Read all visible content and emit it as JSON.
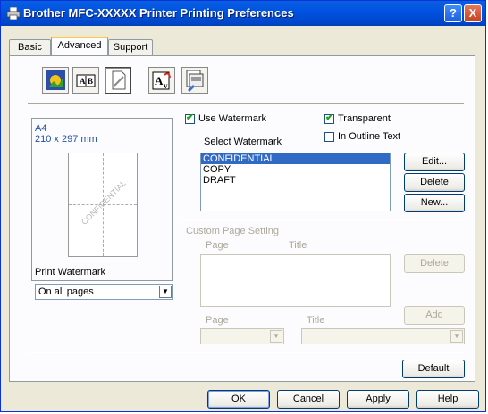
{
  "window": {
    "title": "Brother MFC-XXXXX Printer Printing Preferences",
    "help_glyph": "?",
    "close_glyph": "X"
  },
  "tabs": [
    "Basic",
    "Advanced",
    "Support"
  ],
  "tools": [
    "color-quality-icon",
    "scaling-icon",
    "watermark-icon",
    "header-footer-icon",
    "device-options-icon"
  ],
  "preview": {
    "paper": "A4",
    "size": "210 x 297 mm",
    "watermark_text": "CONFIDENTIAL"
  },
  "print_watermark": {
    "label": "Print Watermark",
    "value": "On all pages"
  },
  "use_watermark": {
    "label": "Use Watermark",
    "checked": true
  },
  "transparent": {
    "label": "Transparent",
    "checked": true
  },
  "in_outline": {
    "label": "In Outline Text",
    "checked": false
  },
  "select_watermark": {
    "label": "Select Watermark",
    "items": [
      "CONFIDENTIAL",
      "COPY",
      "DRAFT"
    ],
    "selected": "CONFIDENTIAL"
  },
  "watermark_buttons": {
    "edit": "Edit...",
    "delete": "Delete",
    "new": "New..."
  },
  "custom": {
    "label": "Custom Page Setting",
    "col_page": "Page",
    "col_title": "Title",
    "delete": "Delete",
    "add": "Add",
    "page_label": "Page",
    "title_label": "Title"
  },
  "default_button": "Default",
  "footer": {
    "ok": "OK",
    "cancel": "Cancel",
    "apply": "Apply",
    "help": "Help"
  }
}
